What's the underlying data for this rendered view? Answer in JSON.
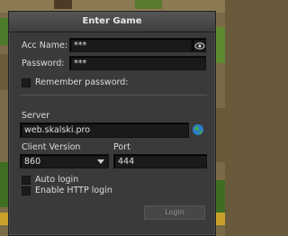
{
  "dialog": {
    "title": "Enter Game"
  },
  "account": {
    "acc_name_label": "Acc Name:",
    "acc_name_value": "***",
    "password_label": "Password:",
    "password_value": "***",
    "remember_label": "Remember password:"
  },
  "server": {
    "label": "Server",
    "value": "web.skalski.pro",
    "client_version_label": "Client Version",
    "client_version_value": "860",
    "port_label": "Port",
    "port_value": "444"
  },
  "options": {
    "auto_login_label": "Auto login",
    "enable_http_label": "Enable HTTP login"
  },
  "buttons": {
    "login_label": "Login"
  },
  "icons": {
    "show_password": "eye-icon",
    "server_list": "globe-icon",
    "version_dropdown": "chevron-down-icon"
  },
  "colors": {
    "dialog_bg": "#3a3a3a",
    "input_bg": "#1a1a1a",
    "text": "#dcdcdc"
  }
}
